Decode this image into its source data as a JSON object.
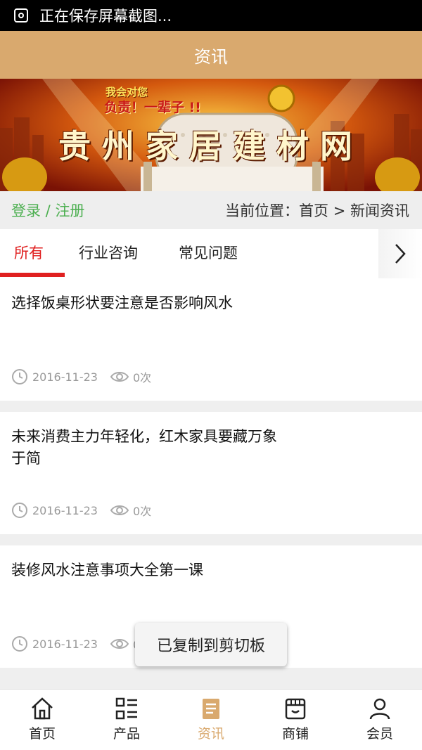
{
  "status_bar": {
    "text": "正在保存屏幕截图..."
  },
  "app_bar": {
    "title": "资讯"
  },
  "banner": {
    "headline_1": "我会对您",
    "headline_2": "负责！一辈子 !!",
    "site_title": "贵州家居建材网"
  },
  "breadcrumb_bar": {
    "login": "登录",
    "slash": " / ",
    "register": "注册",
    "location": "当前位置：首页 > 新闻资讯"
  },
  "tabs": [
    {
      "label": "所有",
      "active": true
    },
    {
      "label": "行业咨询",
      "active": false
    },
    {
      "label": "常见问题",
      "active": false
    }
  ],
  "articles": [
    {
      "title": "选择饭桌形状要注意是否影响风水",
      "date": "2016-11-23",
      "views": "0次"
    },
    {
      "title": "未来消费主力年轻化，红木家具要藏万象于简",
      "date": "2016-11-23",
      "views": "0次"
    },
    {
      "title": "装修风水注意事项大全第一课",
      "date": "2016-11-23",
      "views": "0次"
    }
  ],
  "toast": {
    "text": "已复制到剪切板"
  },
  "bottom_nav": [
    {
      "label": "首页",
      "icon": "home-icon",
      "active": false
    },
    {
      "label": "产品",
      "icon": "product-grid-icon",
      "active": false
    },
    {
      "label": "资讯",
      "icon": "news-icon",
      "active": true
    },
    {
      "label": "商铺",
      "icon": "shop-icon",
      "active": false
    },
    {
      "label": "会员",
      "icon": "user-icon",
      "active": false
    }
  ],
  "colors": {
    "accent": "#d9a96e",
    "tab_active": "#e02020",
    "login_green": "#4caf50",
    "meta_grey": "#999999"
  }
}
